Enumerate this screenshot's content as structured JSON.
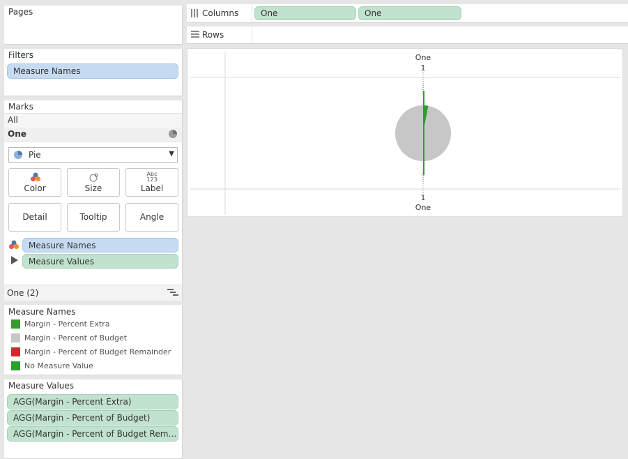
{
  "pages": {
    "title": "Pages"
  },
  "filters": {
    "title": "Filters",
    "pill": "Measure Names"
  },
  "marks": {
    "title": "Marks",
    "all_label": "All",
    "card_label": "One",
    "mark_type": "Pie",
    "buttons": {
      "color": "Color",
      "size": "Size",
      "label": "Label",
      "label_icon": "Abc\n123",
      "detail": "Detail",
      "tooltip": "Tooltip",
      "angle": "Angle"
    },
    "fields": [
      {
        "label": "Measure Names",
        "icon": "color-icon"
      },
      {
        "label": "Measure Values",
        "icon": "angle-icon"
      }
    ],
    "footer": "One (2)"
  },
  "measure_names_legend": {
    "title": "Measure Names",
    "items": [
      {
        "label": "Margin - Percent Extra",
        "color": "#2ca02c"
      },
      {
        "label": "Margin - Percent of Budget",
        "color": "#c7c7c7"
      },
      {
        "label": "Margin - Percent of Budget Remainder",
        "color": "#d62728"
      },
      {
        "label": "No Measure Value",
        "color": "#2ca02c"
      }
    ]
  },
  "measure_values": {
    "title": "Measure Values",
    "items": [
      "AGG(Margin - Percent Extra)",
      "AGG(Margin - Percent of Budget)",
      "AGG(Margin - Percent of Budget Remainde.."
    ]
  },
  "columns": {
    "label": "Columns",
    "pills": [
      "One",
      "One"
    ]
  },
  "rows": {
    "label": "Rows"
  },
  "chart": {
    "top_axis_title": "One",
    "top_tick": "1",
    "bottom_tick": "1",
    "bottom_axis_title": "One"
  },
  "chart_data": {
    "type": "pie",
    "slices": [
      {
        "name": "Margin - Percent Extra",
        "value": 3,
        "color": "#2ca02c"
      },
      {
        "name": "Margin - Percent of Budget",
        "value": 97,
        "color": "#c7c7c7"
      }
    ],
    "x_tick_labels": [
      "1"
    ],
    "xlabel": "One"
  }
}
